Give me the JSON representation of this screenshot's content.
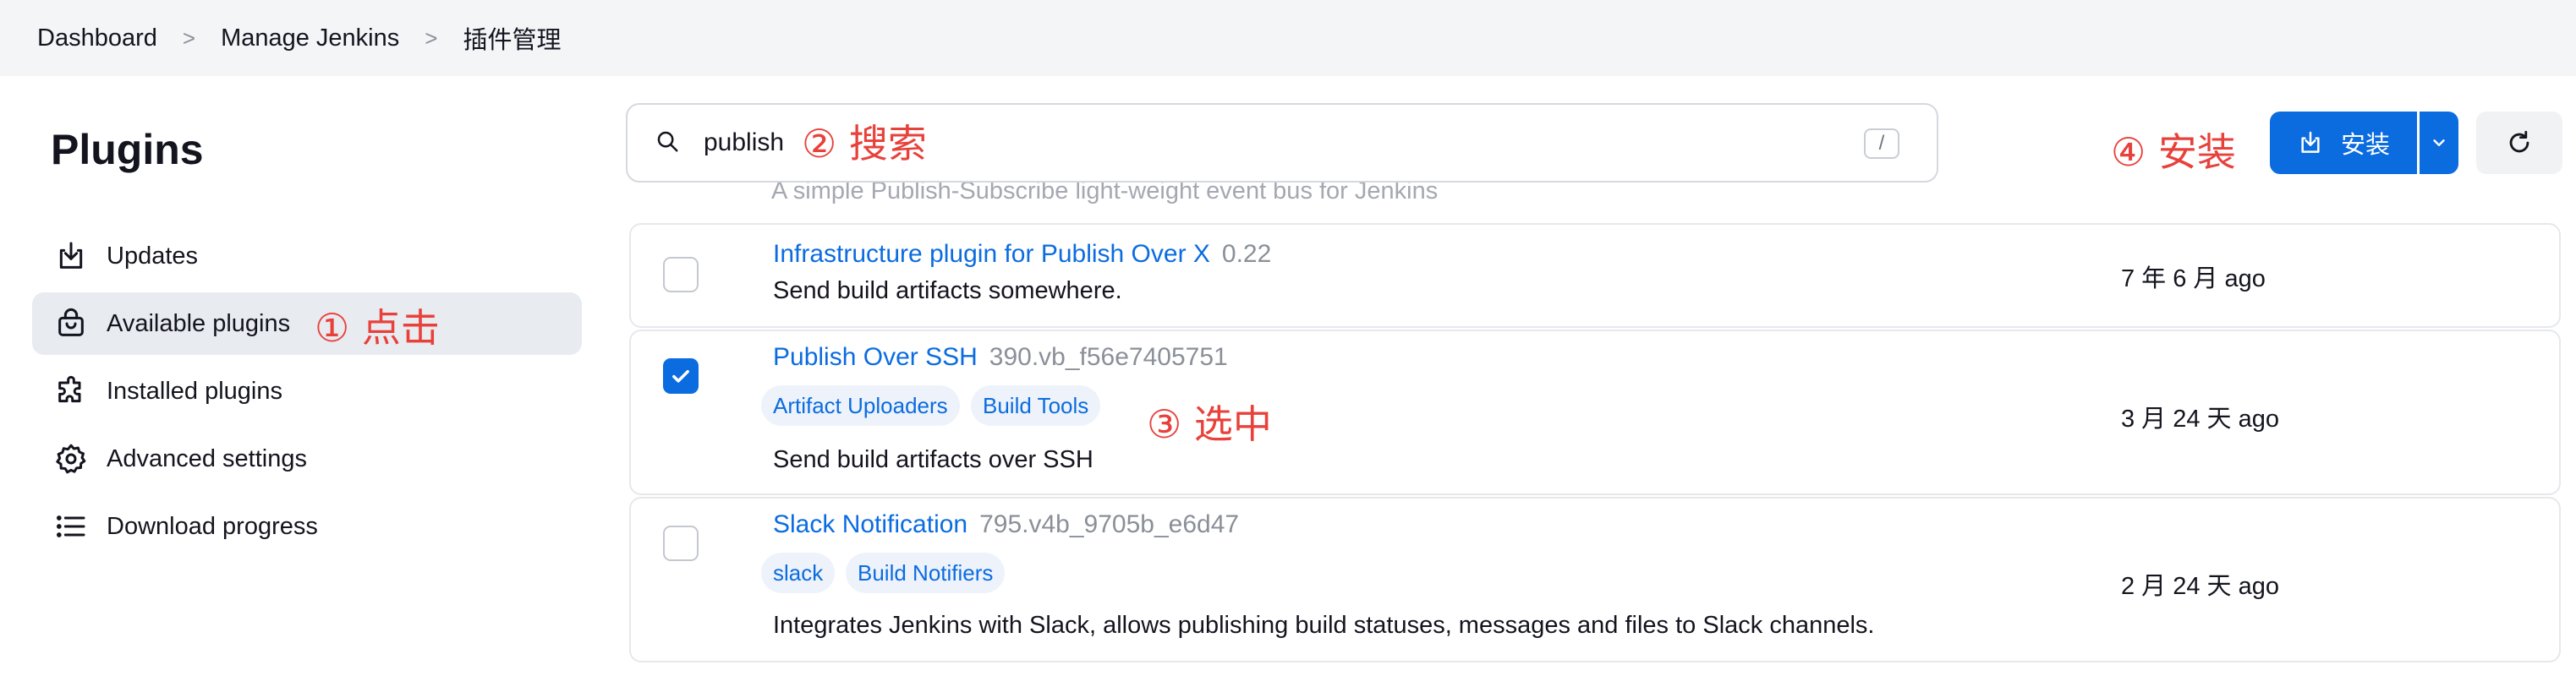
{
  "breadcrumb": {
    "items": [
      "Dashboard",
      "Manage Jenkins",
      "插件管理"
    ],
    "separator": ">"
  },
  "sidebar": {
    "title": "Plugins",
    "items": [
      {
        "label": "Updates",
        "icon": "download-icon"
      },
      {
        "label": "Available plugins",
        "icon": "shopping-bag-icon",
        "active": true
      },
      {
        "label": "Installed plugins",
        "icon": "puzzle-icon"
      },
      {
        "label": "Advanced settings",
        "icon": "gear-icon"
      },
      {
        "label": "Download progress",
        "icon": "list-icon"
      }
    ]
  },
  "annotations": {
    "click": "① 点击",
    "search": "② 搜索",
    "select": "③ 选中",
    "install": "④ 安装"
  },
  "search": {
    "value": "publish",
    "shortcut": "/"
  },
  "toolbar": {
    "install_label": "安装"
  },
  "plugins": {
    "faded_description": "A simple Publish-Subscribe light-weight event bus for Jenkins",
    "rows": [
      {
        "name": "Infrastructure plugin for Publish Over X",
        "version": "0.22",
        "tags": [],
        "description": "Send build artifacts somewhere.",
        "released": "7 年 6 月 ago",
        "checked": false
      },
      {
        "name": "Publish Over SSH",
        "version": "390.vb_f56e7405751",
        "tags": [
          "Artifact Uploaders",
          "Build Tools"
        ],
        "description": "Send build artifacts over SSH",
        "released": "3 月 24 天 ago",
        "checked": true
      },
      {
        "name": "Slack Notification",
        "version": "795.v4b_9705b_e6d47",
        "tags": [
          "slack",
          "Build Notifiers"
        ],
        "description": "Integrates Jenkins with Slack, allows publishing build statuses, messages and files to Slack channels.",
        "released": "2 月 24 天 ago",
        "checked": false
      }
    ]
  },
  "colors": {
    "accent": "#0b6ce0",
    "annotation": "#e8413b",
    "sidebar_active": "#e8ebf0"
  }
}
